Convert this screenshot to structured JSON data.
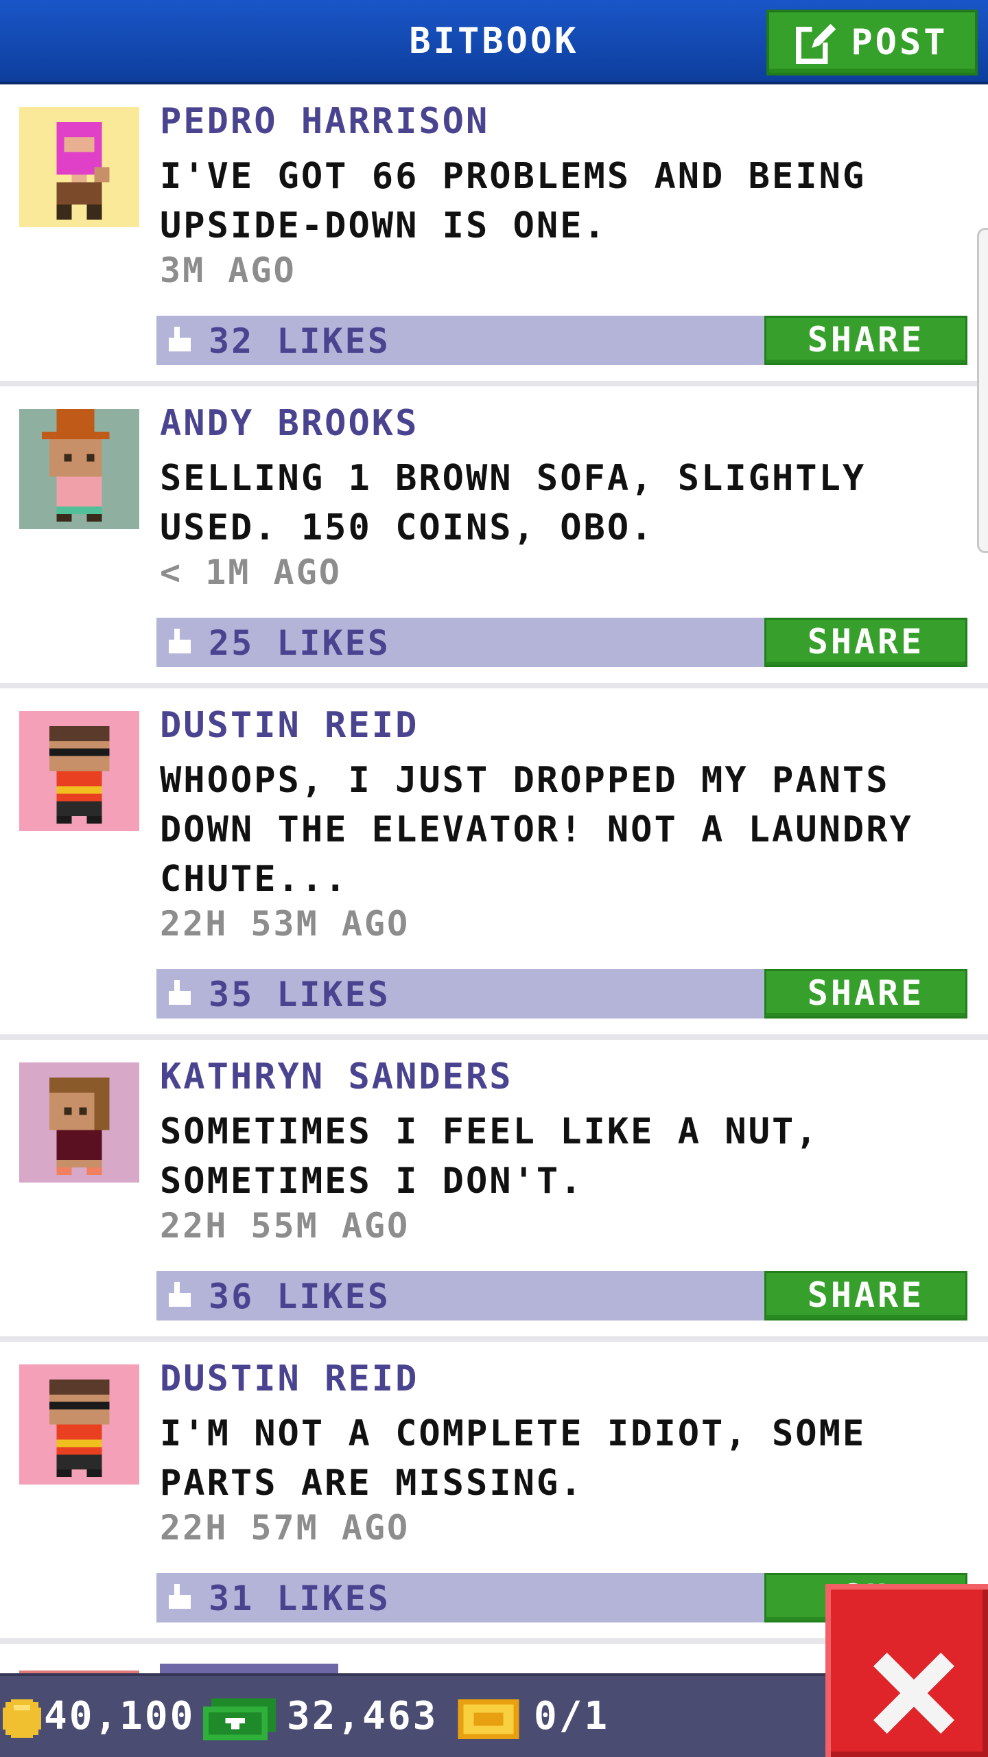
{
  "header": {
    "title": "BITBOOK",
    "post_label": "POST"
  },
  "posts": [
    {
      "author": "PEDRO HARRISON",
      "message": "I'VE GOT 66 PROBLEMS AND BEING UPSIDE-DOWN IS ONE.",
      "time": "3M AGO",
      "likes": "32 LIKES",
      "share_label": "SHARE",
      "avatar_bg": "#fbe99a"
    },
    {
      "author": "ANDY BROOKS",
      "message": "SELLING 1 BROWN SOFA, SLIGHTLY USED. 150 COINS, OBO.",
      "time": "< 1M AGO",
      "likes": "25 LIKES",
      "share_label": "SHARE",
      "avatar_bg": "#8fb0a0"
    },
    {
      "author": "DUSTIN REID",
      "message": "WHOOPS, I JUST DROPPED MY PANTS DOWN THE ELEVATOR! NOT A LAUNDRY CHUTE...",
      "time": "22H 53M AGO",
      "likes": "35 LIKES",
      "share_label": "SHARE",
      "avatar_bg": "#f4a0b8"
    },
    {
      "author": "KATHRYN SANDERS",
      "message": "SOMETIMES I FEEL LIKE A NUT, SOMETIMES I DON'T.",
      "time": "22H 55M AGO",
      "likes": "36 LIKES",
      "share_label": "SHARE",
      "avatar_bg": "#d8a8c8"
    },
    {
      "author": "DUSTIN REID",
      "message": "I'M NOT A COMPLETE IDIOT, SOME PARTS ARE MISSING.",
      "time": "22H 57M AGO",
      "likes": "31 LIKES",
      "share_label": "SH",
      "avatar_bg": "#f4a0b8"
    }
  ],
  "bottom_bar": {
    "coins": "40,100",
    "bux": "32,463",
    "tickets": "0/1"
  },
  "colors": {
    "header_blue": "#1a56c8",
    "share_green": "#37a02c",
    "like_bar": "#b4b4d8",
    "author_purple": "#4a4490",
    "close_red": "#e0252a"
  },
  "icons": {
    "post": "edit-icon",
    "like": "thumbs-up-icon",
    "coin": "coin-icon",
    "bux": "cash-icon",
    "ticket": "ticket-icon",
    "close": "close-icon"
  }
}
